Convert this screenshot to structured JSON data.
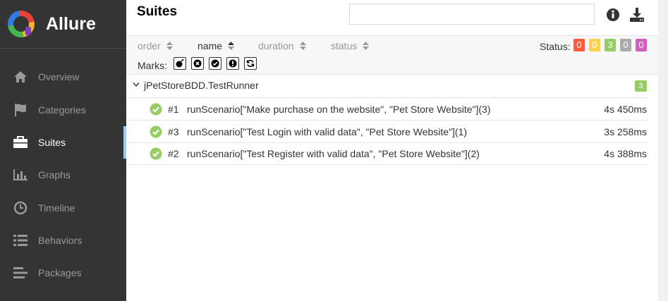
{
  "app": {
    "name": "Allure"
  },
  "sidebar": {
    "items": [
      {
        "label": "Overview",
        "icon": "home-icon",
        "active": false
      },
      {
        "label": "Categories",
        "icon": "flag-icon",
        "active": false
      },
      {
        "label": "Suites",
        "icon": "briefcase-icon",
        "active": true
      },
      {
        "label": "Graphs",
        "icon": "bar-chart-icon",
        "active": false
      },
      {
        "label": "Timeline",
        "icon": "clock-icon",
        "active": false
      },
      {
        "label": "Behaviors",
        "icon": "list-icon",
        "active": false
      },
      {
        "label": "Packages",
        "icon": "align-left-icon",
        "active": false
      }
    ]
  },
  "header": {
    "title": "Suites",
    "search_value": "",
    "icons": [
      "info-icon",
      "download-icon"
    ]
  },
  "toolbar": {
    "sort": [
      {
        "label": "order",
        "active": false
      },
      {
        "label": "name",
        "active": true
      },
      {
        "label": "duration",
        "active": false
      },
      {
        "label": "status",
        "active": false
      }
    ],
    "status_label": "Status:",
    "statuses": [
      {
        "name": "failed",
        "count": "0",
        "color": "#fd5a3e"
      },
      {
        "name": "broken",
        "count": "0",
        "color": "#ffd050"
      },
      {
        "name": "passed",
        "count": "3",
        "color": "#97cc64"
      },
      {
        "name": "skipped",
        "count": "0",
        "color": "#aaaaaa"
      },
      {
        "name": "unknown",
        "count": "0",
        "color": "#d35ebe"
      }
    ],
    "marks_label": "Marks:",
    "marks": [
      "bomb-icon",
      "times-circle-icon",
      "check-circle-icon",
      "exclamation-circle-icon",
      "refresh-icon"
    ]
  },
  "suite": {
    "name": "jPetStoreBDD.TestRunner",
    "count": "3",
    "tests": [
      {
        "order": "#1",
        "name": "runScenario[\"Make purchase on the website\", \"Pet Store Website\"](3)",
        "duration": "4s 450ms",
        "status": "passed"
      },
      {
        "order": "#3",
        "name": "runScenario[\"Test Login with valid data\", \"Pet Store Website\"](1)",
        "duration": "3s 258ms",
        "status": "passed"
      },
      {
        "order": "#2",
        "name": "runScenario[\"Test Register with valid data\", \"Pet Store Website\"](2)",
        "duration": "4s 388ms",
        "status": "passed"
      }
    ]
  }
}
